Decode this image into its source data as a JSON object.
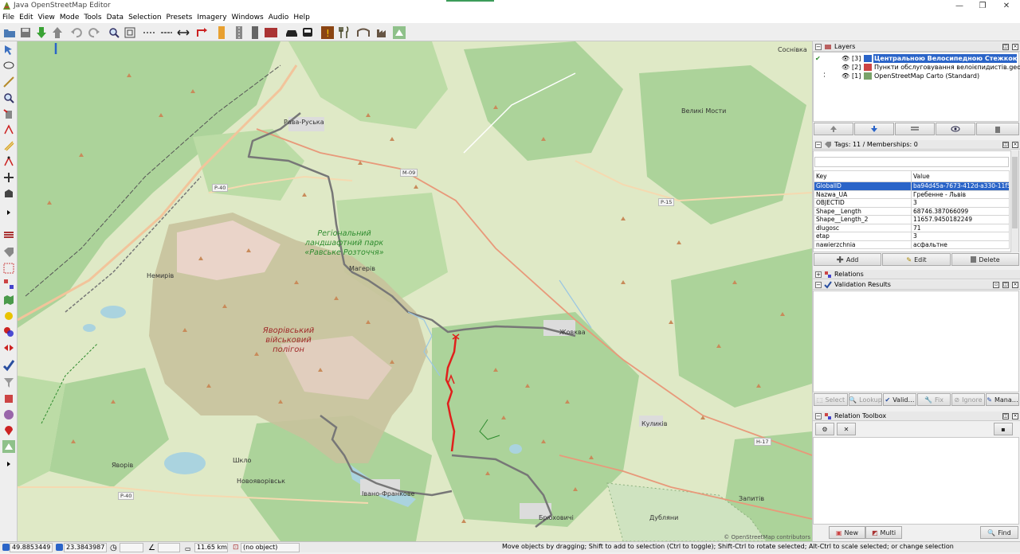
{
  "app": {
    "title": "Java OpenStreetMap Editor"
  },
  "window_controls": {
    "minimize": "—",
    "maximize": "❐",
    "close": "✕"
  },
  "menu": [
    "File",
    "Edit",
    "View",
    "Mode",
    "Tools",
    "Data",
    "Selection",
    "Presets",
    "Imagery",
    "Windows",
    "Audio",
    "Help"
  ],
  "map": {
    "places": {
      "sosnivka": "Соснівка",
      "velyki_mosty": "Великі Мости",
      "rava_ruska": "Рава-Руська",
      "nemyriv": "Немирів",
      "mahriv": "Магерів",
      "zhovkva": "Жовква",
      "kulykiv": "Куликів",
      "shklo": "Шкло",
      "yavoriv": "Яворів",
      "novoiavorivsk": "Новояворівськ",
      "ivano_frankove": "Івано-Франкове",
      "briukhovychi": "Брюховичі",
      "dublany": "Дубляни",
      "zapytiv": "Запитів"
    },
    "shields": {
      "m09": "M-09",
      "p40a": "P-40",
      "p40b": "P-40",
      "p15": "P-15",
      "h17": "H-17"
    },
    "park_label": "Регіональний ландшафтний парк «Равське Розточчя»",
    "military_label": "Яворівський військовий полігон",
    "attribution": "© OpenStreetMap contributors"
  },
  "layers_panel": {
    "title": "Layers",
    "rows": [
      {
        "index": "[3]",
        "name": "Центральною Велосипедною Стежкою Роз…",
        "selected": true
      },
      {
        "index": "[2]",
        "name": "Пункти обслуговування велоієпидистів.geojson",
        "selected": false
      },
      {
        "index": "[1]",
        "name": "OpenStreetMap Carto (Standard)",
        "selected": false
      }
    ]
  },
  "tags_panel": {
    "title": "Tags: 11 / Memberships: 0",
    "col_key": "Key",
    "col_value": "Value",
    "rows": [
      {
        "key": "GlobalID",
        "value": "ba94d45a-7673-412d-a330-11f5b…"
      },
      {
        "key": "Nazwa_UA",
        "value": "Гребенне - Львів"
      },
      {
        "key": "OBJECTID",
        "value": "3"
      },
      {
        "key": "Shape__Length",
        "value": "68746.387066099"
      },
      {
        "key": "Shape__Length_2",
        "value": "11657.9450182249"
      },
      {
        "key": "dlugosc",
        "value": "71"
      },
      {
        "key": "etap",
        "value": "3"
      },
      {
        "key": "nawierzchnia",
        "value": "асфальтне"
      }
    ],
    "add": "Add",
    "edit": "Edit",
    "delete": "Delete"
  },
  "relations_panel": {
    "title": "Relations"
  },
  "validation_panel": {
    "title": "Validation Results",
    "select": "Select",
    "lookup": "Lookup",
    "validate": "Valid…",
    "fix": "Fix",
    "ignore": "Ignore",
    "manage": "Mana…"
  },
  "relation_toolbox": {
    "title": "Relation Toolbox",
    "new": "New",
    "multi": "Multi",
    "find": "Find"
  },
  "status": {
    "lat": "49.8853449",
    "lon": "23.3843987",
    "distance": "11.65 km",
    "object": "(no object)",
    "help": "Move objects by dragging; Shift to add to selection (Ctrl to toggle); Shift-Ctrl to rotate selected; Alt-Ctrl to scale selected; or change selection"
  },
  "colors": {
    "selection": "#2a64c8",
    "route": "#e0201c",
    "park": "#2e8b2e"
  }
}
